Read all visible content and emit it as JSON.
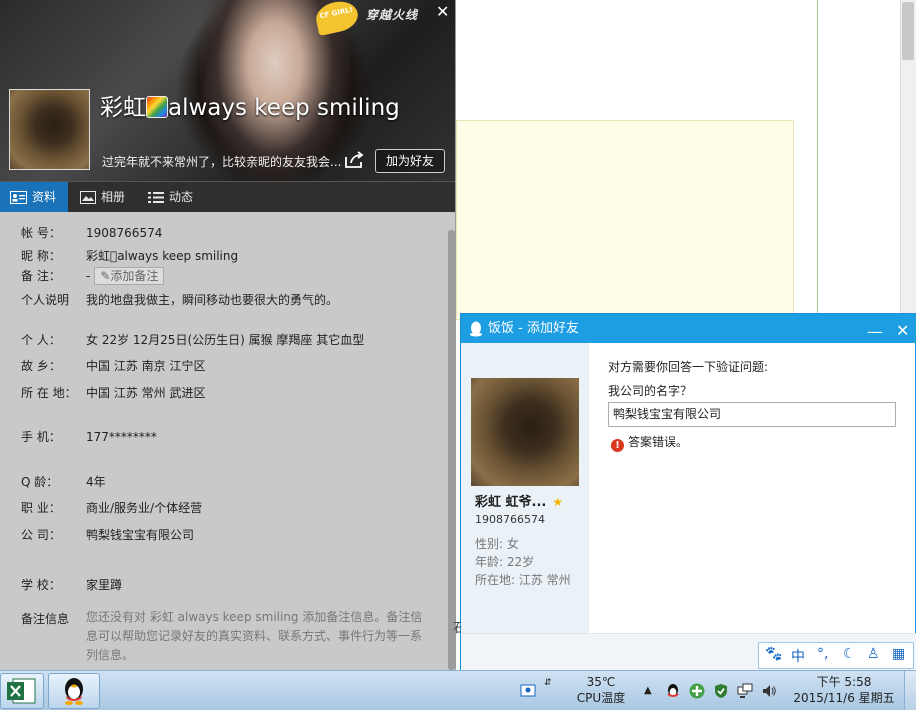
{
  "profile": {
    "nickname": "彩虹",
    "nickname_suffix": "always keep  smiling",
    "signature": "过完年就不来常州了，比较亲昵的友友我会...",
    "add_friend_label": "加为好友",
    "banner_logo_text": "CF GIRL!",
    "banner_logo2_text": "穿越火线",
    "tabs": [
      {
        "label": "资料"
      },
      {
        "label": "相册"
      },
      {
        "label": "动态"
      }
    ],
    "fields": {
      "account": {
        "label": "帐    号：",
        "value": "1908766574"
      },
      "nick": {
        "label": "昵    称：",
        "value": "彩虹\u0000always keep  smiling"
      },
      "remark": {
        "label": "备    注：",
        "value": "-",
        "button": "添加备注"
      },
      "bio": {
        "label": "个人说明",
        "value": "我的地盘我做主，瞬间移动也要很大的勇气的。"
      },
      "personal": {
        "label": "个    人：",
        "value": "女    22岁    12月25日(公历生日)    属猴    摩羯座    其它血型"
      },
      "hometown": {
        "label": "故    乡：",
        "value": "中国 江苏 南京 江宁区"
      },
      "location": {
        "label": "所 在 地：",
        "value": "中国 江苏 常州 武进区"
      },
      "mobile": {
        "label": "手    机：",
        "value": "177********"
      },
      "qage": {
        "label": "Q    龄：",
        "value": "4年"
      },
      "job": {
        "label": "职    业：",
        "value": "商业/服务业/个体经营"
      },
      "company": {
        "label": "公    司：",
        "value": "鸭梨钱宝宝有限公司"
      },
      "school": {
        "label": "学    校：",
        "value": "家里蹲"
      },
      "remark_info": {
        "label": "备注信息",
        "value": "您还没有对 彩虹   always keep  smiling 添加备注信息。备注信息可以帮助您记录好友的真实资料、联系方式、事件行为等一系列信息。"
      }
    }
  },
  "dialog": {
    "title": "饭饭 - 添加好友",
    "min_label": "—",
    "close_label": "✕",
    "friend_nick": "彩虹   虹爷...",
    "friend_qq": "1908766574",
    "gender": "性别: 女",
    "age": "年龄: 22岁",
    "location": "所在地: 江苏  常州",
    "question_intro": "对方需要你回答一下验证问题:",
    "question": "我公司的名字？",
    "answer": "鸭梨钱宝宝有限公司",
    "error": "答案错误。",
    "side_note": "石"
  },
  "ime": {
    "mode": "中",
    "punct": "°,"
  },
  "taskbar": {
    "temperature": "35℃",
    "temp_label": "CPU温度",
    "time": "下午 5:58",
    "date": "2015/11/6 星期五"
  },
  "colors": {
    "accent": "#1d9ee3",
    "tab_active": "#1a73b8",
    "error": "#d9381e",
    "star": "#f2b600"
  },
  "icons": [
    "profile-card-icon",
    "album-icon",
    "feed-icon",
    "share-icon",
    "qq-penguin-icon",
    "excel-icon",
    "error-icon",
    "star-icon"
  ]
}
